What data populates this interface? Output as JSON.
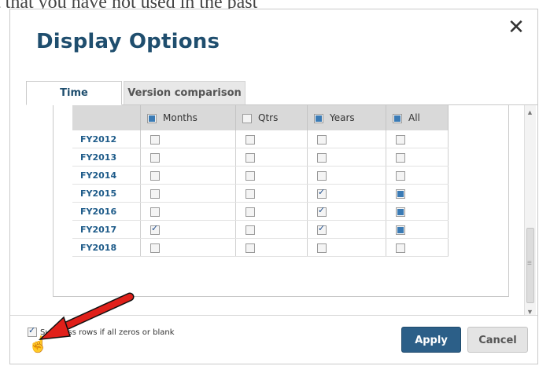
{
  "background_text": "t that you have not used in the past",
  "dialog": {
    "title": "Display Options",
    "close_glyph": "✕"
  },
  "tabs": [
    {
      "label": "Time",
      "active": true
    },
    {
      "label": "Version comparison",
      "active": false
    }
  ],
  "grid": {
    "headers": [
      "Months",
      "Qtrs",
      "Years",
      "All"
    ],
    "header_checkbox_states": [
      "filled",
      "unchecked",
      "filled",
      "filled"
    ],
    "rows": [
      {
        "year": "FY2012",
        "months": "unchecked",
        "qtrs": "unchecked",
        "years": "unchecked",
        "all": "unchecked"
      },
      {
        "year": "FY2013",
        "months": "unchecked",
        "qtrs": "unchecked",
        "years": "unchecked",
        "all": "unchecked"
      },
      {
        "year": "FY2014",
        "months": "unchecked",
        "qtrs": "unchecked",
        "years": "unchecked",
        "all": "unchecked"
      },
      {
        "year": "FY2015",
        "months": "unchecked",
        "qtrs": "unchecked",
        "years": "checked",
        "all": "filled"
      },
      {
        "year": "FY2016",
        "months": "unchecked",
        "qtrs": "unchecked",
        "years": "checked",
        "all": "filled"
      },
      {
        "year": "FY2017",
        "months": "checked",
        "qtrs": "unchecked",
        "years": "checked",
        "all": "filled"
      },
      {
        "year": "FY2018",
        "months": "unchecked",
        "qtrs": "unchecked",
        "years": "unchecked",
        "all": "unchecked"
      }
    ]
  },
  "footer": {
    "suppress_label": "Suppress rows if all zeros or blank",
    "suppress_checked": true,
    "apply_label": "Apply",
    "cancel_label": "Cancel"
  },
  "icons": {
    "close": "close-icon",
    "arrow": "red-arrow-icon",
    "cursor": "hand-cursor-icon"
  },
  "colors": {
    "title": "#1f4e6e",
    "apply_button": "#2c5f88",
    "arrow": "#e0201a",
    "year_link": "#1f5c8a"
  }
}
